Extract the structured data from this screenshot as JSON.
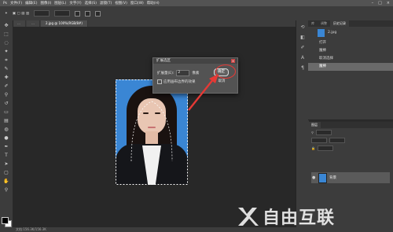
{
  "dialog": {
    "title": "扩展选区",
    "expand_label": "扩展量(E):",
    "expand_value": "2",
    "unit": "像素",
    "checkbox_label": "应用画布边界的效果",
    "ok_label": "确定",
    "cancel_label": "取消"
  },
  "document": {
    "tab": "2.jpg @ 100%(RGB/8#)"
  },
  "history_panel": {
    "tabs": [
      "库",
      "调整",
      "历史记录"
    ],
    "snapshot": "2.jpg",
    "items": [
      "打开",
      "魔棒",
      "取消选择",
      "魔棒"
    ]
  },
  "layers_panel": {
    "tabs": [
      "图层"
    ],
    "layer_name": "背景"
  },
  "status": {
    "text": "文档:156.3K/156.3K"
  },
  "watermark": {
    "text": "自由互联"
  },
  "colors": {
    "accent": "#e53935",
    "selection_bg": "#3a86d4"
  }
}
